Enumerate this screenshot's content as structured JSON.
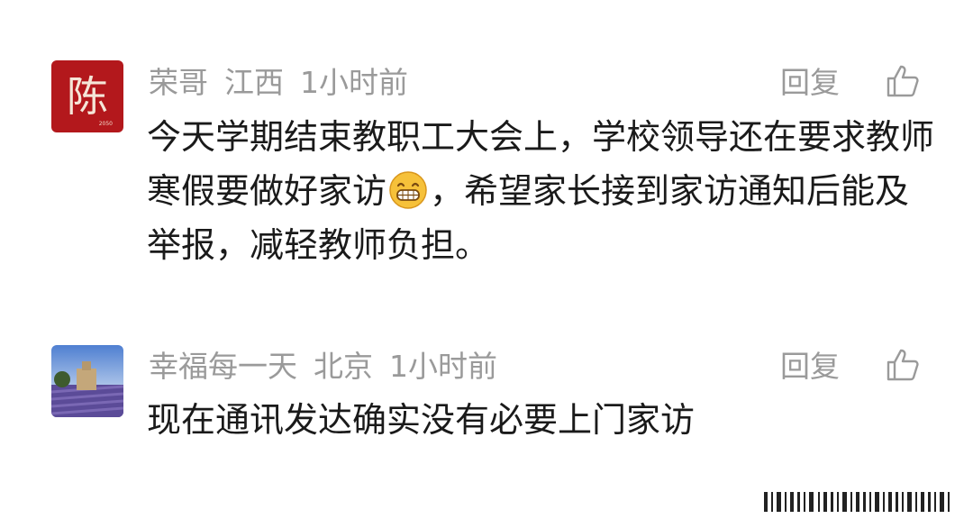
{
  "comments": [
    {
      "username": "荣哥",
      "location": "江西",
      "time": "1小时前",
      "reply_label": "回复",
      "text_before_emoji": "今天学期结束教职工大会上，学校领导还在要求教师寒假要做好家访",
      "emoji": "grinning-face-emoji",
      "text_after_emoji": "，希望家长接到家访通知后能及举报，减轻教师负担。",
      "avatar": {
        "char": "陈",
        "bg": "#b3181c"
      }
    },
    {
      "username": "幸福每一天",
      "location": "北京",
      "time": "1小时前",
      "reply_label": "回复",
      "text": "现在通讯发达确实没有必要上门家访",
      "avatar": {
        "bg_top": "#6a8fd0",
        "bg_bottom": "#5a4a8a"
      }
    }
  ],
  "colors": {
    "meta": "#9a9a9a",
    "text": "#1a1a1a"
  }
}
